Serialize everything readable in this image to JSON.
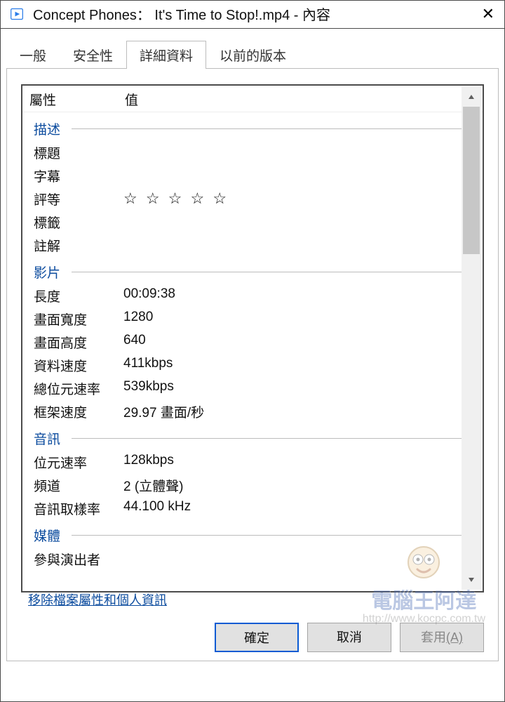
{
  "titlebar": {
    "title": "Concept Phones： It's Time to Stop!.mp4 - 內容"
  },
  "tabs": {
    "general": "一般",
    "security": "安全性",
    "details": "詳細資料",
    "previous": "以前的版本"
  },
  "list": {
    "header_property": "屬性",
    "header_value": "值",
    "sections": {
      "description": "描述",
      "video": "影片",
      "audio": "音訊",
      "media": "媒體"
    },
    "description_rows": {
      "title": "標題",
      "subtitle": "字幕",
      "rating": "評等",
      "tags": "標籤",
      "comments": "註解",
      "rating_value": "☆ ☆ ☆ ☆ ☆"
    },
    "video_rows": {
      "length_label": "長度",
      "length_value": "00:09:38",
      "frame_width_label": "畫面寬度",
      "frame_width_value": "1280",
      "frame_height_label": "畫面高度",
      "frame_height_value": "640",
      "data_rate_label": "資料速度",
      "data_rate_value": "411kbps",
      "total_bitrate_label": "總位元速率",
      "total_bitrate_value": "539kbps",
      "frame_rate_label": "框架速度",
      "frame_rate_value": "29.97 畫面/秒"
    },
    "audio_rows": {
      "bitrate_label": "位元速率",
      "bitrate_value": "128kbps",
      "channels_label": "頻道",
      "channels_value": "2 (立體聲)",
      "sample_rate_label": "音訊取樣率",
      "sample_rate_value": "44.100 kHz"
    },
    "media_rows": {
      "contributing_label": "參與演出者"
    }
  },
  "link": {
    "remove_props": "移除檔案屬性和個人資訊"
  },
  "buttons": {
    "ok": "確定",
    "cancel": "取消",
    "apply_prefix": "套用",
    "apply_shortcut": "(A)"
  },
  "watermark": {
    "label": "電腦王阿達",
    "url": "http://www.kocpc.com.tw"
  }
}
